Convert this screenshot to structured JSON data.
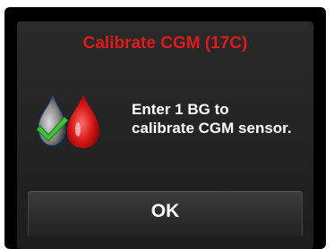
{
  "dialog": {
    "title": "Calibrate CGM (17C)",
    "message_line1": "Enter 1 BG to",
    "message_line2": "calibrate CGM sensor.",
    "ok_label": "OK"
  },
  "icons": {
    "sensor_drop": "gray-drop-with-checkmark-icon",
    "blood_drop": "red-blood-drop-icon"
  },
  "colors": {
    "title": "#e01a1a",
    "checkmark": "#3fc23a",
    "blood": "#d81818"
  }
}
